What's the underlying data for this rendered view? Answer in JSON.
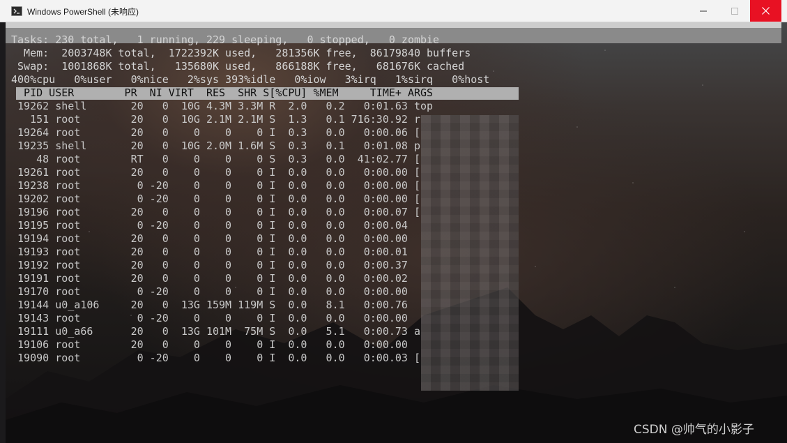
{
  "window": {
    "title": "Windows PowerShell (未响应)",
    "minimize_glyph": "—",
    "maximize_glyph": "☐",
    "close_glyph": "✕",
    "close_color": "#e81123"
  },
  "terminal": {
    "summary_lines": [
      "Tasks: 230 total,   1 running, 229 sleeping,   0 stopped,   0 zombie",
      "  Mem:  2003748K total,  1722392K used,   281356K free,  86179840 buffers",
      " Swap:  1001868K total,   135680K used,   866188K free,   681676K cached",
      "400%cpu   0%user   0%nice   2%sys 393%idle   0%iow   3%irq   1%sirq   0%host"
    ],
    "header": "  PID USER        PR  NI VIRT  RES  SHR S[%CPU] %MEM     TIME+ ARGS          ",
    "processes": [
      " 19262 shell       20   0  10G 4.3M 3.3M R  2.0   0.2   0:01.63 top",
      "   151 root        20   0  10G 2.1M 2.1M S  1.3   0.1 716:30.92 r",
      " 19264 root        20   0    0    0    0 I  0.3   0.0   0:00.06 [",
      " 19235 shell       20   0  10G 2.0M 1.6M S  0.3   0.1   0:01.08 p",
      "    48 root        RT   0    0    0    0 S  0.3   0.0  41:02.77 [",
      " 19261 root        20   0    0    0    0 I  0.0   0.0   0:00.00 [",
      " 19238 root         0 -20    0    0    0 I  0.0   0.0   0:00.00 [",
      " 19202 root         0 -20    0    0    0 I  0.0   0.0   0:00.00 [",
      " 19196 root        20   0    0    0    0 I  0.0   0.0   0:00.07 [",
      " 19195 root         0 -20    0    0    0 I  0.0   0.0   0:00.04",
      " 19194 root        20   0    0    0    0 I  0.0   0.0   0:00.00",
      " 19193 root        20   0    0    0    0 I  0.0   0.0   0:00.01",
      " 19192 root        20   0    0    0    0 I  0.0   0.0   0:00.37",
      " 19191 root        20   0    0    0    0 I  0.0   0.0   0:00.02",
      " 19170 root         0 -20    0    0    0 I  0.0   0.0   0:00.00",
      " 19144 u0_a106     20   0  13G 159M 119M S  0.0   8.1   0:00.76",
      " 19143 root         0 -20    0    0    0 I  0.0   0.0   0:00.00",
      " 19111 u0_a66      20   0  13G 101M  75M S  0.0   5.1   0:00.73 a",
      " 19106 root        20   0    0    0    0 I  0.0   0.0   0:00.00",
      " 19090 root         0 -20    0    0    0 I  0.0   0.0   0:00.03 ["
    ]
  },
  "watermark": "CSDN @帅气的小影子",
  "colors": {
    "titlebar_bg": "#f3f3f3",
    "header_bg": "#b0b0b0",
    "terminal_text": "#c7c7c7"
  }
}
